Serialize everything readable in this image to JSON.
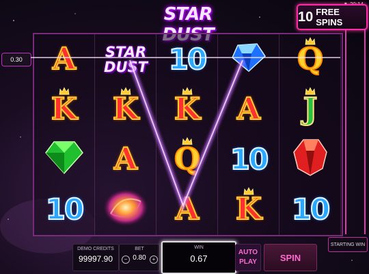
{
  "status": {
    "time": "20:14"
  },
  "logo": {
    "text": "STAR DUST"
  },
  "free_spins": {
    "count": "10",
    "label": "FREE SPINS"
  },
  "bet_line_value": "0.30",
  "reels": [
    [
      {
        "type": "letter",
        "text": "A"
      },
      {
        "type": "letter",
        "text": "K",
        "crown": true
      },
      {
        "type": "gem",
        "gem": "emerald"
      },
      {
        "type": "ten",
        "text": "10"
      }
    ],
    [
      {
        "type": "wild",
        "text": "STAR\nDUST"
      },
      {
        "type": "letter",
        "text": "K",
        "crown": true
      },
      {
        "type": "letter",
        "text": "A"
      },
      {
        "type": "galaxy"
      }
    ],
    [
      {
        "type": "ten",
        "text": "10"
      },
      {
        "type": "letter",
        "text": "K",
        "crown": true
      },
      {
        "type": "q",
        "text": "Q",
        "crown": true
      },
      {
        "type": "letter",
        "text": "A"
      }
    ],
    [
      {
        "type": "gem",
        "gem": "sapphire"
      },
      {
        "type": "letter",
        "text": "A"
      },
      {
        "type": "ten",
        "text": "10"
      },
      {
        "type": "letter",
        "text": "K",
        "crown": true
      }
    ],
    [
      {
        "type": "q",
        "text": "Q",
        "crown": true
      },
      {
        "type": "j",
        "text": "J",
        "crown": true
      },
      {
        "type": "gem",
        "gem": "ruby"
      },
      {
        "type": "ten",
        "text": "10"
      }
    ]
  ],
  "bottom": {
    "credits_label": "DEMO CREDITS",
    "credits_value": "99997.90",
    "bet_label": "BET",
    "bet_value": "0.80",
    "win_label": "WIN",
    "win_value": "0.67",
    "autoplay_label": "AUTO PLAY",
    "spin_label": "SPIN",
    "starting_win_label": "STARTING WIN"
  },
  "colors": {
    "accent": "#ff2aa8",
    "win_line": "#c86aff"
  }
}
